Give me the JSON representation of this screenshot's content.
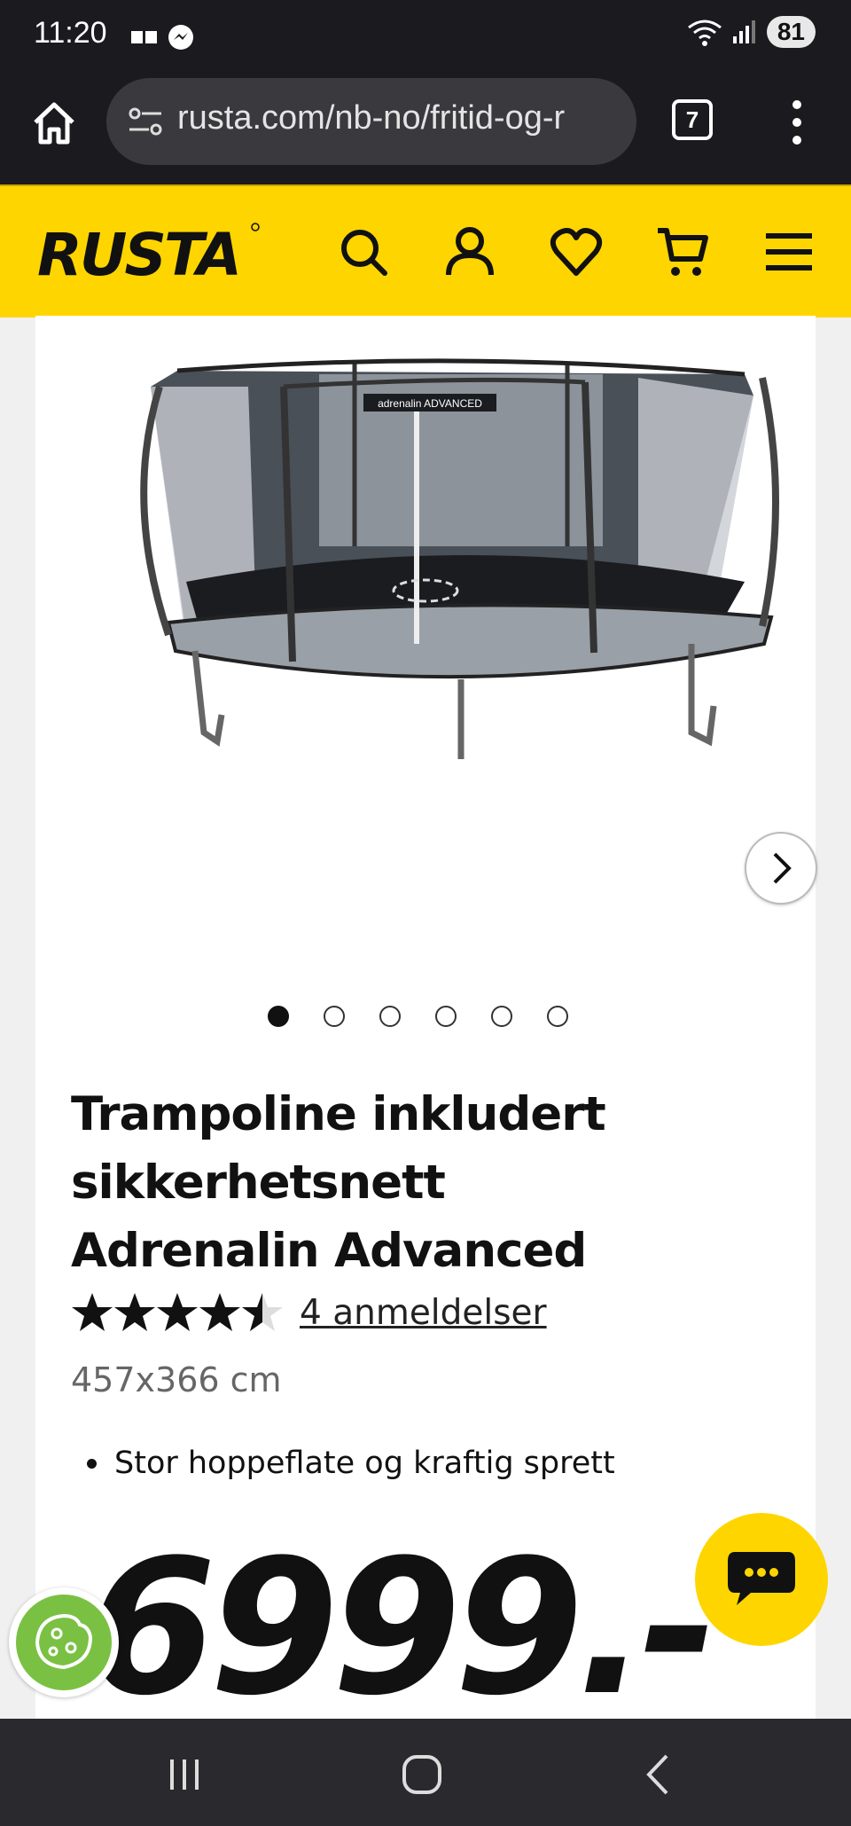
{
  "status_bar": {
    "time": "11:20",
    "battery": "81"
  },
  "browser": {
    "url": "rusta.com/nb-no/fritid-og-r",
    "tab_count": "7"
  },
  "header": {
    "logo_text": "RUSTA",
    "brand_color": "#ffd500"
  },
  "product": {
    "title": "Trampoline inkludert sikkerhetsnett Adrenalin Advanced",
    "rating": 4.5,
    "rating_max": 5,
    "reviews_label": "4 anmeldelser",
    "size": "457x366 cm",
    "features": [
      "Stor hoppeflate og kraftig sprett"
    ],
    "price": "6999.-",
    "image_banner": "adrenalin ADVANCED"
  },
  "gallery": {
    "image_count": 6,
    "active_index": 0
  }
}
